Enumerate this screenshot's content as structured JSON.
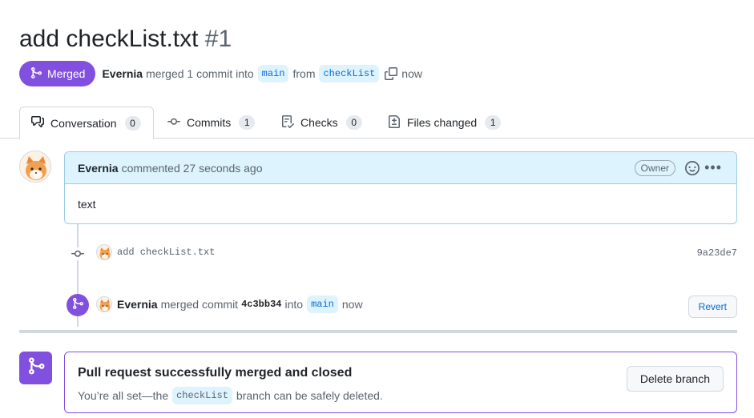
{
  "pr": {
    "title": "add checkList.txt",
    "number": "#1",
    "status": "Merged",
    "author": "Evernia",
    "summary_action": "merged 1 commit into",
    "base_branch": "main",
    "from_word": "from",
    "head_branch": "checkList",
    "time": "now"
  },
  "tabs": [
    {
      "label": "Conversation",
      "count": "0",
      "icon": "comment-discussion-icon",
      "active": true
    },
    {
      "label": "Commits",
      "count": "1",
      "icon": "git-commit-icon"
    },
    {
      "label": "Checks",
      "count": "0",
      "icon": "checklist-icon"
    },
    {
      "label": "Files changed",
      "count": "1",
      "icon": "file-diff-icon"
    }
  ],
  "comment": {
    "author": "Evernia",
    "meta": "commented 27 seconds ago",
    "role_badge": "Owner",
    "body": "text"
  },
  "timeline": {
    "commit_message": "add checkList.txt",
    "commit_sha": "9a23de7",
    "merge_author": "Evernia",
    "merge_text": "merged commit",
    "merge_sha": "4c3bb34",
    "merge_into": "into",
    "merge_branch": "main",
    "merge_time": "now",
    "revert_label": "Revert"
  },
  "merged_box": {
    "title": "Pull request successfully merged and closed",
    "sub_prefix": "You’re all set—the",
    "branch": "checkList",
    "sub_suffix": "branch can be safely deleted.",
    "delete_label": "Delete branch"
  },
  "colors": {
    "merged_purple": "#8250df",
    "link_blue": "#0969da",
    "comment_header_bg": "#ddf4ff"
  }
}
